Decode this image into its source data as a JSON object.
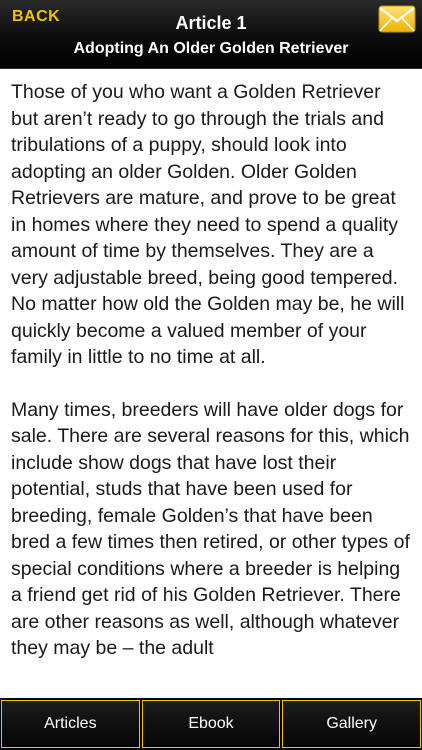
{
  "header": {
    "back_label": "BACK",
    "article_number": "Article 1",
    "article_title": "Adopting An Older Golden Retriever",
    "mail_icon": "envelope-icon",
    "accent_color": "#f2c200"
  },
  "content": {
    "paragraphs": [
      "Those of you who want a Golden Retriever but aren’t ready to go through the trials and tribulations of a puppy, should look into adopting an older Golden. Older Golden Retrievers are mature, and prove to be great in homes where they need to spend a quality amount of time by themselves. They are a very adjustable breed, being good tempered. No matter how old the Golden may be, he will quickly become a valued member of your family in little to no time at all.",
      "Many times, breeders will have older dogs for sale. There are several reasons for this, which include show dogs that have lost their potential, studs that have been used for breeding, female Golden’s that have been bred a few times then retired, or other types of special conditions where a breeder is helping a friend get rid of his Golden Retriever. There are other reasons as well, although whatever they may be – the adult"
    ]
  },
  "tabbar": {
    "tabs": [
      {
        "label": "Articles"
      },
      {
        "label": "Ebook"
      },
      {
        "label": "Gallery"
      }
    ]
  }
}
